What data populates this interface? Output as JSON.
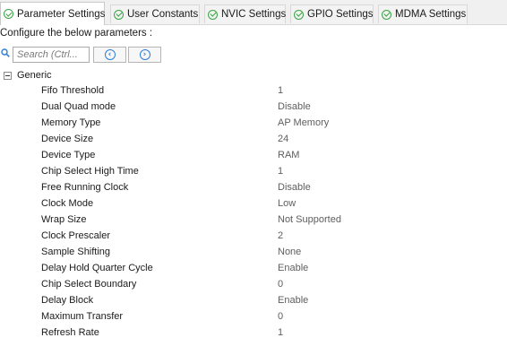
{
  "tabs": [
    {
      "label": "Parameter Settings",
      "status_icon": "check-circle-icon",
      "active": true
    },
    {
      "label": "User Constants",
      "status_icon": "check-circle-icon",
      "active": false
    },
    {
      "label": "NVIC Settings",
      "status_icon": "check-circle-icon",
      "active": false
    },
    {
      "label": "GPIO Settings",
      "status_icon": "check-circle-icon",
      "active": false
    },
    {
      "label": "MDMA Settings",
      "status_icon": "check-circle-icon",
      "active": false
    }
  ],
  "configure_label": "Configure the below parameters :",
  "search": {
    "placeholder": "Search (Ctrl...",
    "value": ""
  },
  "nav": {
    "prev_icon": "chevron-left-icon",
    "next_icon": "chevron-right-icon",
    "prev_glyph": "‹",
    "next_glyph": "›"
  },
  "group": {
    "label": "Generic",
    "expanded": true
  },
  "parameters": [
    {
      "name": "Fifo Threshold",
      "value": "1"
    },
    {
      "name": "Dual Quad mode",
      "value": "Disable"
    },
    {
      "name": "Memory Type",
      "value": "AP Memory"
    },
    {
      "name": "Device Size",
      "value": "24"
    },
    {
      "name": "Device Type",
      "value": "RAM"
    },
    {
      "name": "Chip Select High Time",
      "value": "1"
    },
    {
      "name": "Free Running Clock",
      "value": "Disable"
    },
    {
      "name": "Clock Mode",
      "value": "Low"
    },
    {
      "name": "Wrap Size",
      "value": "Not Supported"
    },
    {
      "name": "Clock Prescaler",
      "value": "2"
    },
    {
      "name": "Sample Shifting",
      "value": "None"
    },
    {
      "name": "Delay Hold Quarter Cycle",
      "value": "Enable"
    },
    {
      "name": "Chip Select Boundary",
      "value": "0"
    },
    {
      "name": "Delay Block",
      "value": "Enable"
    },
    {
      "name": "Maximum Transfer",
      "value": "0"
    },
    {
      "name": "Refresh Rate",
      "value": "1"
    }
  ],
  "colors": {
    "accent_green": "#3aa344",
    "accent_blue": "#2f7ed8",
    "value_text": "#5e5e5e"
  }
}
